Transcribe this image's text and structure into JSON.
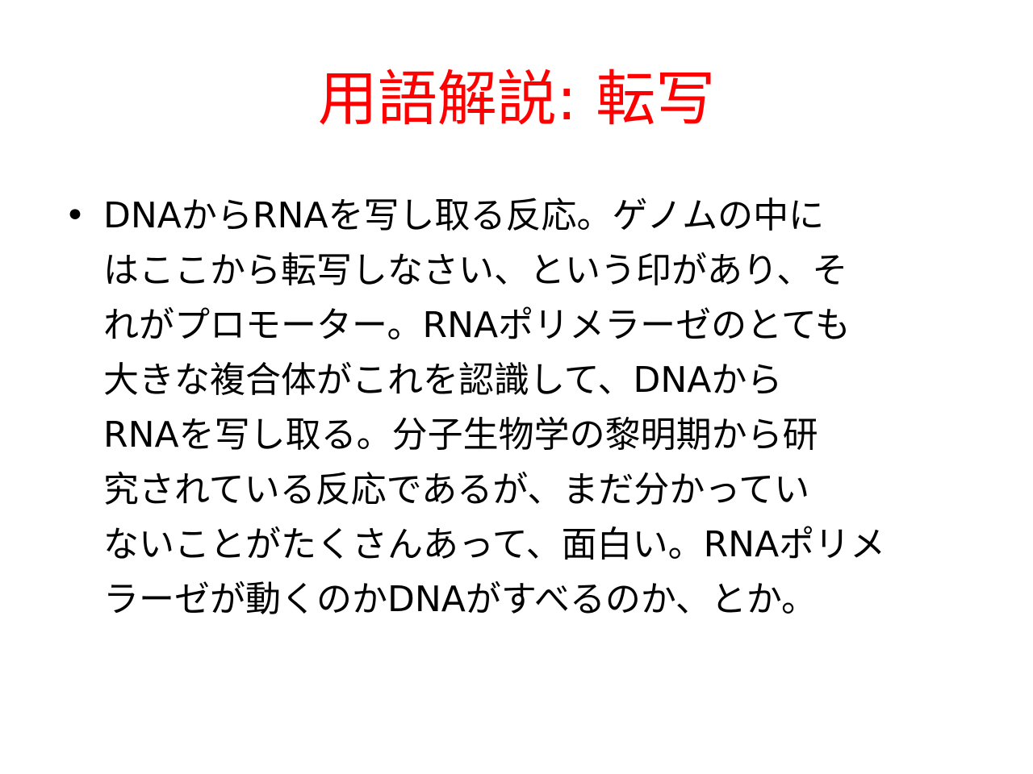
{
  "slide": {
    "title": "用語解説: 転写",
    "bullet_symbol": "•",
    "bullet_lines": [
      "DNAからRNAを写し取る反応。ゲノムの中に",
      "はここから転写しなさい、という印があり、そ",
      "れがプロモーター。RNAポリメラーゼのとても",
      "大きな複合体がこれを認識して、DNAから",
      "RNAを写し取る。分子生物学の黎明期から研",
      "究されている反応であるが、まだ分かってい",
      "ないことがたくさんあって、面白い。RNAポリメ",
      "ラーゼが動くのかDNAがすべるのか、とか。"
    ]
  },
  "colors": {
    "title": "#ff0000",
    "body_text": "#000000",
    "background": "#ffffff"
  }
}
